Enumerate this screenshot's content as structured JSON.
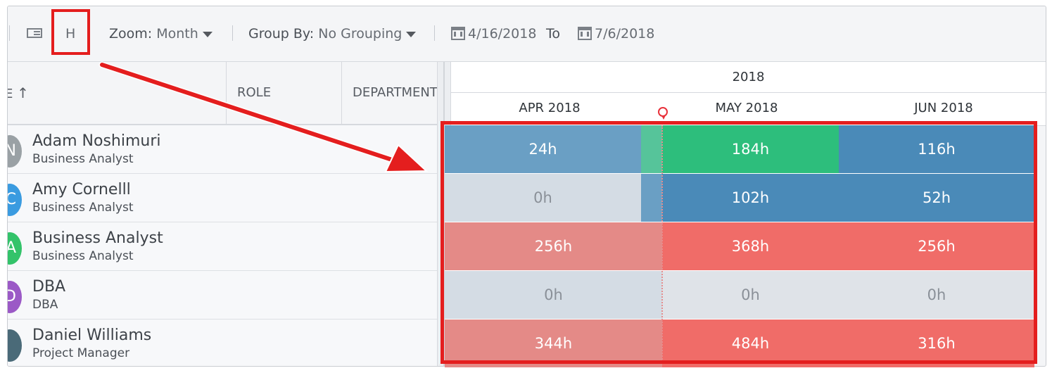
{
  "toolbar": {
    "h_label": "H",
    "zoom_label": "Zoom:",
    "zoom_value": "Month",
    "group_label": "Group By:",
    "group_value": "No Grouping",
    "date_from": "4/16/2018",
    "to_label": "To",
    "date_to": "7/6/2018"
  },
  "columns": {
    "name": "E",
    "role": "ROLE",
    "department": "DEPARTMENT"
  },
  "timeline": {
    "year": "2018",
    "months": [
      "APR 2018",
      "MAY 2018",
      "JUN 2018"
    ]
  },
  "people": [
    {
      "name": "Adam Noshimuri",
      "role": "Business Analyst",
      "initial": "N",
      "avatar_color": "#9aa1a5"
    },
    {
      "name": "Amy Cornelll",
      "role": "Business Analyst",
      "initial": "C",
      "avatar_color": "#3a9be0"
    },
    {
      "name": "Business Analyst",
      "role": "Business Analyst",
      "initial": "A",
      "avatar_color": "#33c36a"
    },
    {
      "name": "DBA",
      "role": "DBA",
      "initial": "D",
      "avatar_color": "#9b59c6"
    },
    {
      "name": "Daniel Williams",
      "role": "Project Manager",
      "initial": "",
      "avatar_color": "#4a6a78"
    }
  ],
  "hours": [
    {
      "apr": "24h",
      "may": "184h",
      "jun": "116h"
    },
    {
      "apr": "0h",
      "may": "102h",
      "jun": "52h"
    },
    {
      "apr": "256h",
      "may": "368h",
      "jun": "256h"
    },
    {
      "apr": "0h",
      "may": "0h",
      "jun": "0h"
    },
    {
      "apr": "344h",
      "may": "484h",
      "jun": "316h"
    }
  ],
  "colors": {
    "blue": "#4a8ab8",
    "green": "#2dbe7c",
    "red": "#f06c68",
    "gray": "#dfe3e8",
    "annotation_red": "#e41e1e"
  }
}
